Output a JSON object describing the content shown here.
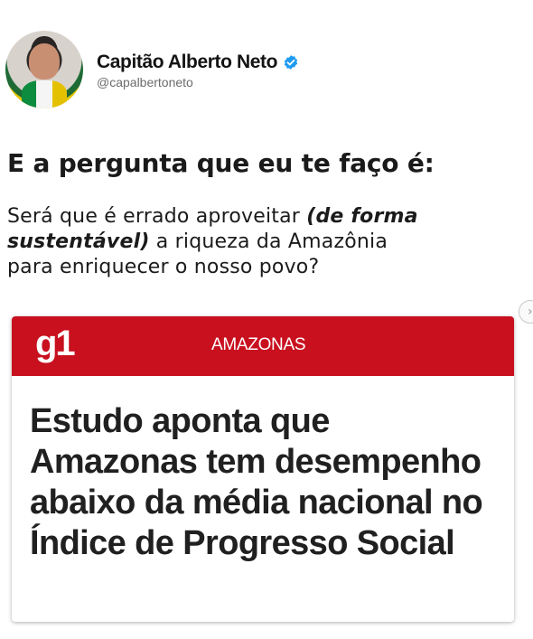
{
  "profile": {
    "display_name": "Capitão Alberto Neto",
    "handle": "@capalbertoneto",
    "verified_color": "#1d9bf0",
    "avatar_icon": "profile-photo"
  },
  "post": {
    "headline": "E a pergunta que eu te faço é:",
    "body_line_1_prefix": "Será que é errado aproveitar ",
    "body_line_1_em": "(de forma",
    "body_line_2_em": "sustentável)",
    "body_line_2_suffix": " a riqueza da Amazônia",
    "body_line_3": "para enriquecer o nosso povo?"
  },
  "carousel": {
    "next_icon": "chevron-right-icon",
    "next_glyph": "›"
  },
  "news_card": {
    "brand": "g1",
    "section": "AMAZONAS",
    "brand_color": "#c8101f",
    "title": "Estudo aponta que Amazonas tem desempenho abaixo da média nacional no Índice de Progresso Social"
  }
}
